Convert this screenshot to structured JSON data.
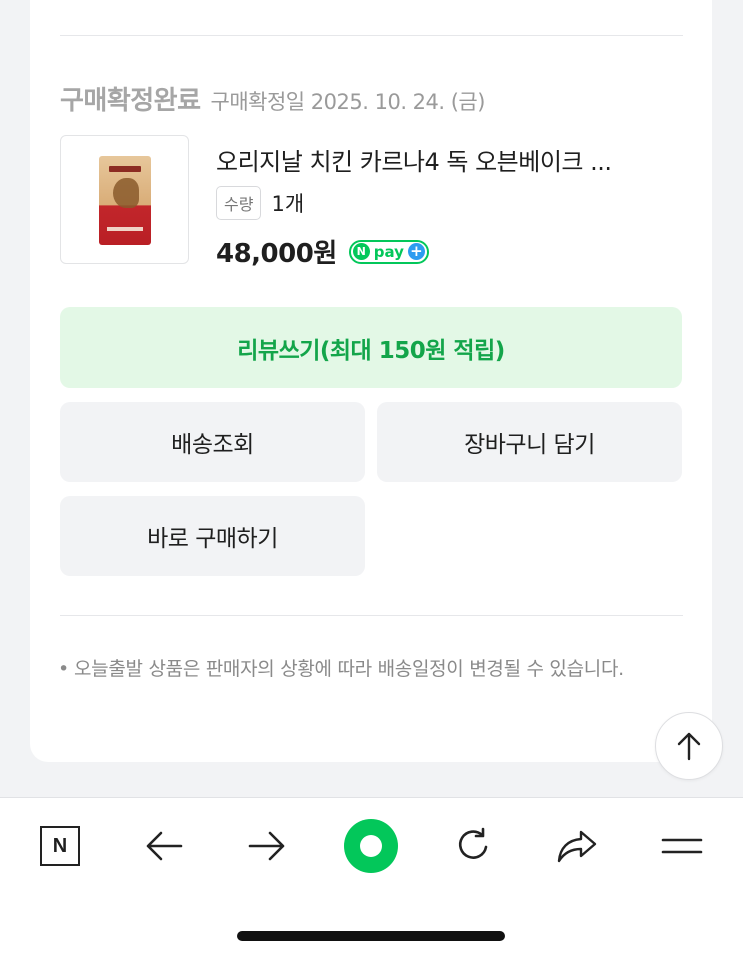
{
  "order": {
    "status": "구매확정완료",
    "confirm_date": "구매확정일 2025. 10. 24. (금)"
  },
  "product": {
    "name": "오리지날 치킨 카르나4 독 오븐베이크 ...",
    "qty_label": "수량",
    "qty_value": "1개",
    "price": "48,000원",
    "pay_badge": {
      "n": "N",
      "text": "pay",
      "plus": "+"
    }
  },
  "actions": {
    "review": "리뷰쓰기(최대 150원 적립)",
    "track": "배송조회",
    "cart": "장바구니 담기",
    "buy_now": "바로 구매하기"
  },
  "notice": {
    "bullet": "•",
    "text": "오늘출발 상품은 판매자의 상황에 따라 배송일정이 변경될 수 있습니다."
  },
  "bottom_nav": {
    "n_label": "N",
    "items": [
      "n-home-icon",
      "back-arrow-icon",
      "forward-arrow-icon",
      "green-dot-icon",
      "refresh-icon",
      "share-icon",
      "menu-icon"
    ]
  },
  "colors": {
    "accent_green": "#03c75a",
    "review_bg": "#e3f8e6",
    "review_text": "#13a54a",
    "button_bg": "#f2f3f5",
    "plus_blue": "#2d9cf0"
  }
}
